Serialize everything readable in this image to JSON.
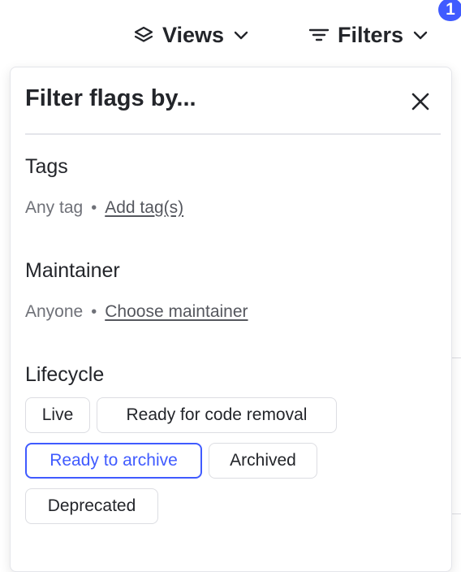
{
  "toolbar": {
    "views_label": "Views",
    "filters_label": "Filters",
    "filters_count": "1"
  },
  "popover": {
    "title": "Filter flags by...",
    "tags": {
      "heading": "Tags",
      "value": "Any tag",
      "separator": "•",
      "link": "Add tag(s)"
    },
    "maintainer": {
      "heading": "Maintainer",
      "value": "Anyone",
      "separator": "•",
      "link": "Choose maintainer"
    },
    "lifecycle": {
      "heading": "Lifecycle",
      "options": [
        {
          "label": "Live",
          "selected": false
        },
        {
          "label": "Ready for code removal",
          "selected": false
        },
        {
          "label": "Ready to archive",
          "selected": true
        },
        {
          "label": "Archived",
          "selected": false
        },
        {
          "label": "Deprecated",
          "selected": false
        }
      ]
    }
  },
  "colors": {
    "accent": "#405bff",
    "text": "#23252a",
    "muted": "#6f7178",
    "border": "#dcdde2"
  }
}
